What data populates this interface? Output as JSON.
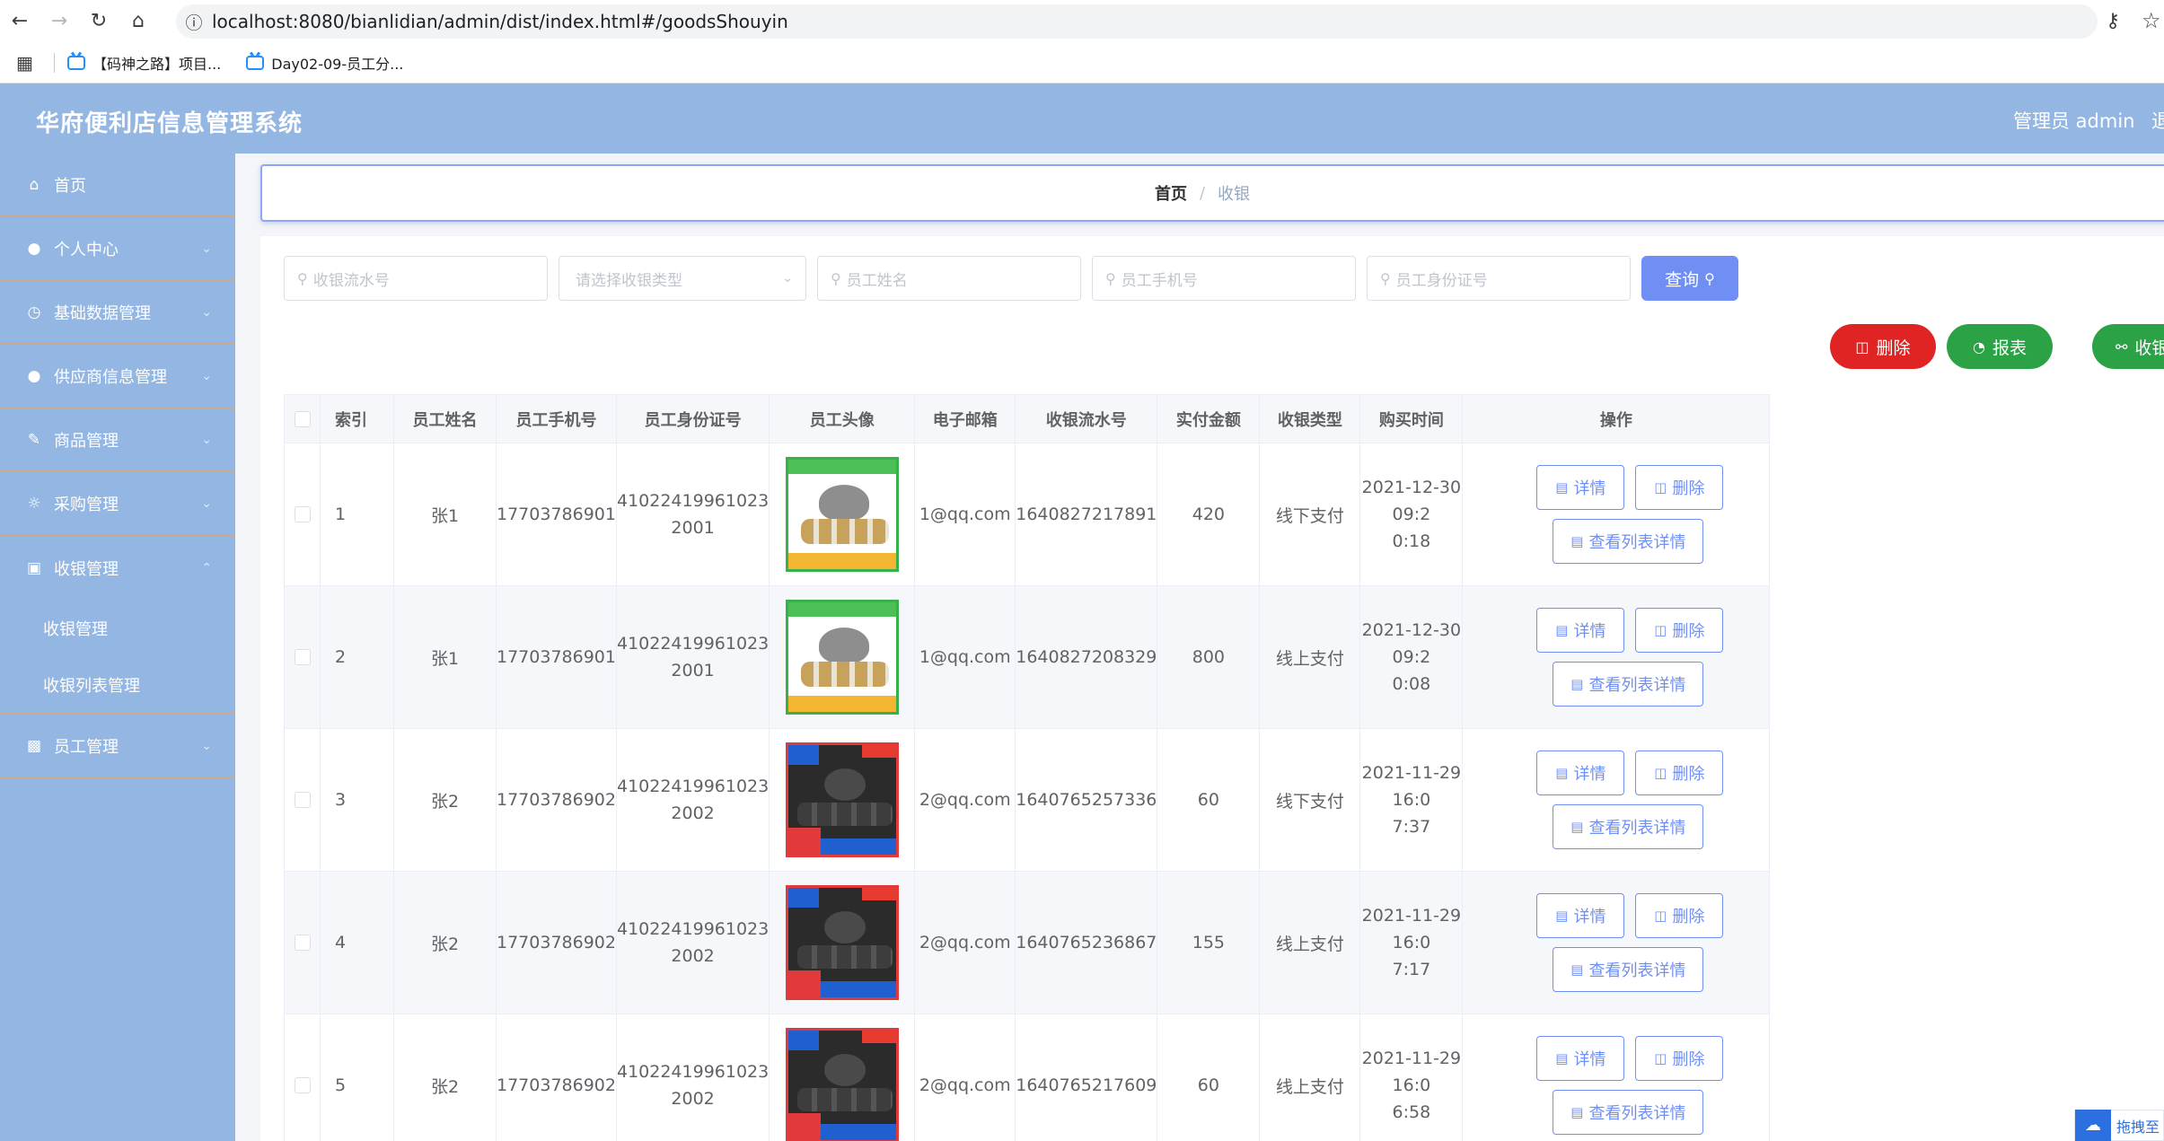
{
  "browser": {
    "url": "localhost:8080/bianlidian/admin/dist/index.html#/goodsShouyin",
    "bookmarks": [
      "【码神之路】项目...",
      "Day02-09-员工分..."
    ]
  },
  "header": {
    "title": "华府便利店信息管理系统",
    "admin": "管理员 admin",
    "logout_partial": "退"
  },
  "sidebar": {
    "items": [
      {
        "label": "首页",
        "icon": "home-icon",
        "arrow": false
      },
      {
        "label": "个人中心",
        "icon": "user-icon",
        "arrow": true
      },
      {
        "label": "基础数据管理",
        "icon": "clock-icon",
        "arrow": true
      },
      {
        "label": "供应商信息管理",
        "icon": "user-icon",
        "arrow": true
      },
      {
        "label": "商品管理",
        "icon": "edit-icon",
        "arrow": true
      },
      {
        "label": "采购管理",
        "icon": "compass-icon",
        "arrow": true
      },
      {
        "label": "收银管理",
        "icon": "bag-icon",
        "arrow": true,
        "expanded": true
      },
      {
        "label": "员工管理",
        "icon": "briefcase-icon",
        "arrow": true
      }
    ],
    "sub_items": [
      "收银管理",
      "收银列表管理"
    ]
  },
  "breadcrumb": {
    "home": "首页",
    "separator": "/",
    "current": "收银"
  },
  "search": {
    "serial_placeholder": "收银流水号",
    "type_placeholder": "请选择收银类型",
    "name_placeholder": "员工姓名",
    "phone_placeholder": "员工手机号",
    "idcard_placeholder": "员工身份证号",
    "query_label": "查询"
  },
  "actions": {
    "delete": "删除",
    "report": "报表",
    "pay": "收银"
  },
  "table": {
    "headers": [
      "索引",
      "员工姓名",
      "员工手机号",
      "员工身份证号",
      "员工头像",
      "电子邮箱",
      "收银流水号",
      "实付金额",
      "收银类型",
      "购买时间",
      "操作"
    ],
    "rows": [
      {
        "index": "1",
        "name": "张1",
        "phone": "17703786901",
        "id_l1": "41022419961023",
        "id_l2": "2001",
        "avatar": "green",
        "email": "1@qq.com",
        "serial": "1640827217891",
        "amount": "420",
        "type": "线下支付",
        "time_l1": "2021-12-30 09:2",
        "time_l2": "0:18"
      },
      {
        "index": "2",
        "name": "张1",
        "phone": "17703786901",
        "id_l1": "41022419961023",
        "id_l2": "2001",
        "avatar": "green",
        "email": "1@qq.com",
        "serial": "1640827208329",
        "amount": "800",
        "type": "线上支付",
        "time_l1": "2021-12-30 09:2",
        "time_l2": "0:08"
      },
      {
        "index": "3",
        "name": "张2",
        "phone": "17703786902",
        "id_l1": "41022419961023",
        "id_l2": "2002",
        "avatar": "dark",
        "email": "2@qq.com",
        "serial": "1640765257336",
        "amount": "60",
        "type": "线下支付",
        "time_l1": "2021-11-29 16:0",
        "time_l2": "7:37"
      },
      {
        "index": "4",
        "name": "张2",
        "phone": "17703786902",
        "id_l1": "41022419961023",
        "id_l2": "2002",
        "avatar": "dark",
        "email": "2@qq.com",
        "serial": "1640765236867",
        "amount": "155",
        "type": "线上支付",
        "time_l1": "2021-11-29 16:0",
        "time_l2": "7:17"
      },
      {
        "index": "5",
        "name": "张2",
        "phone": "17703786902",
        "id_l1": "41022419961023",
        "id_l2": "2002",
        "avatar": "dark",
        "email": "2@qq.com",
        "serial": "1640765217609",
        "amount": "60",
        "type": "线上支付",
        "time_l1": "2021-11-29 16:0",
        "time_l2": "6:58"
      }
    ],
    "op_detail": "详情",
    "op_delete": "删除",
    "op_list": "查看列表详情"
  },
  "widget": {
    "label": "拖拽至"
  }
}
